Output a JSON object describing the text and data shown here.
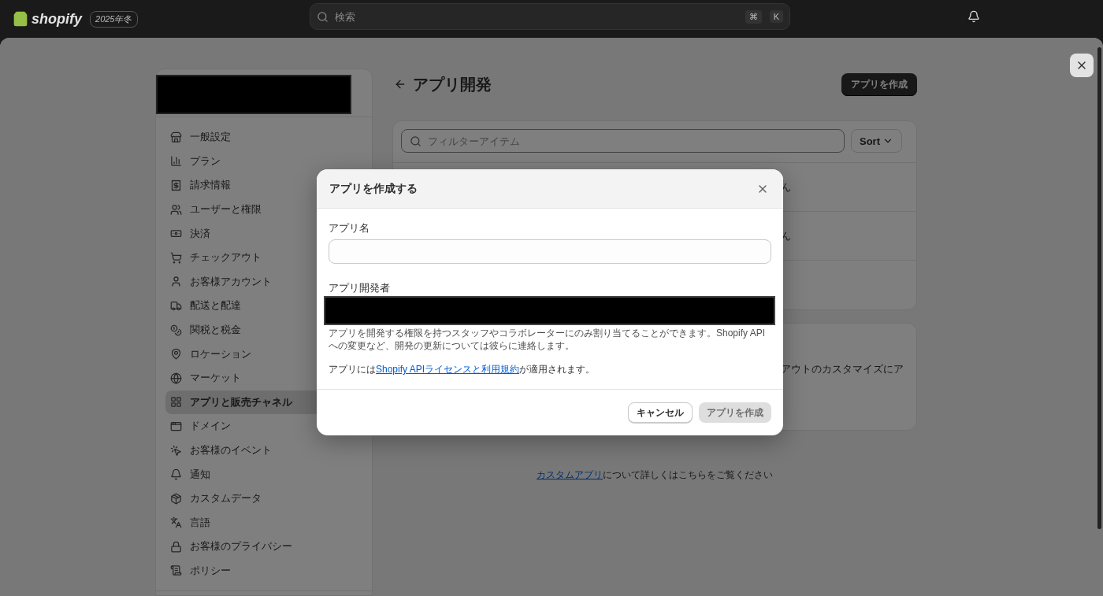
{
  "header": {
    "logo": "shopify",
    "badge": "2025年冬",
    "search": {
      "placeholder": "検索",
      "keys": [
        "⌘",
        "K"
      ]
    }
  },
  "settings": {
    "sidebar": {
      "items": [
        {
          "label": "一般設定",
          "selected": false
        },
        {
          "label": "プラン",
          "selected": false
        },
        {
          "label": "請求情報",
          "selected": false
        },
        {
          "label": "ユーザーと権限",
          "selected": false
        },
        {
          "label": "決済",
          "selected": false
        },
        {
          "label": "チェックアウト",
          "selected": false
        },
        {
          "label": "お客様アカウント",
          "selected": false
        },
        {
          "label": "配送と配達",
          "selected": false
        },
        {
          "label": "関税と税金",
          "selected": false
        },
        {
          "label": "ロケーション",
          "selected": false
        },
        {
          "label": "マーケット",
          "selected": false
        },
        {
          "label": "アプリと販売チャネル",
          "selected": true
        },
        {
          "label": "ドメイン",
          "selected": false
        },
        {
          "label": "お客様のイベント",
          "selected": false
        },
        {
          "label": "通知",
          "selected": false
        },
        {
          "label": "カスタムデータ",
          "selected": false
        },
        {
          "label": "言語",
          "selected": false
        },
        {
          "label": "お客様のプライバシー",
          "selected": false
        },
        {
          "label": "ポリシー",
          "selected": false
        }
      ]
    },
    "page": {
      "title": "アプリ開発",
      "primary_button": "アプリを作成",
      "filter": {
        "placeholder": "フィルターアイテム"
      },
      "sort_button": "Sort",
      "rows": [
        {
          "text": "ん"
        },
        {
          "text": "ん"
        }
      ],
      "card_text": "アウトのカスタマイズにア",
      "footer": {
        "link": "カスタムアプリ",
        "text": "について詳しくはこちらをご覧ください"
      }
    }
  },
  "dialog": {
    "title": "アプリを作成する",
    "name_field": {
      "label": "アプリ名"
    },
    "developer_field": {
      "label": "アプリ開発者"
    },
    "help": "アプリを開発する権限を持つスタッフやコラボレーターにのみ割り当てることができます。Shopify APIへの変更など、開発の更新については彼らに連絡します。",
    "terms": {
      "before": "アプリには",
      "link": "Shopify APIライセンスと利用規約",
      "after": "が適用されます。"
    },
    "buttons": [
      {
        "label": "キャンセル",
        "kind": "secondary",
        "disabled": false
      },
      {
        "label": "アプリを作成",
        "kind": "primary",
        "disabled": true
      }
    ]
  }
}
